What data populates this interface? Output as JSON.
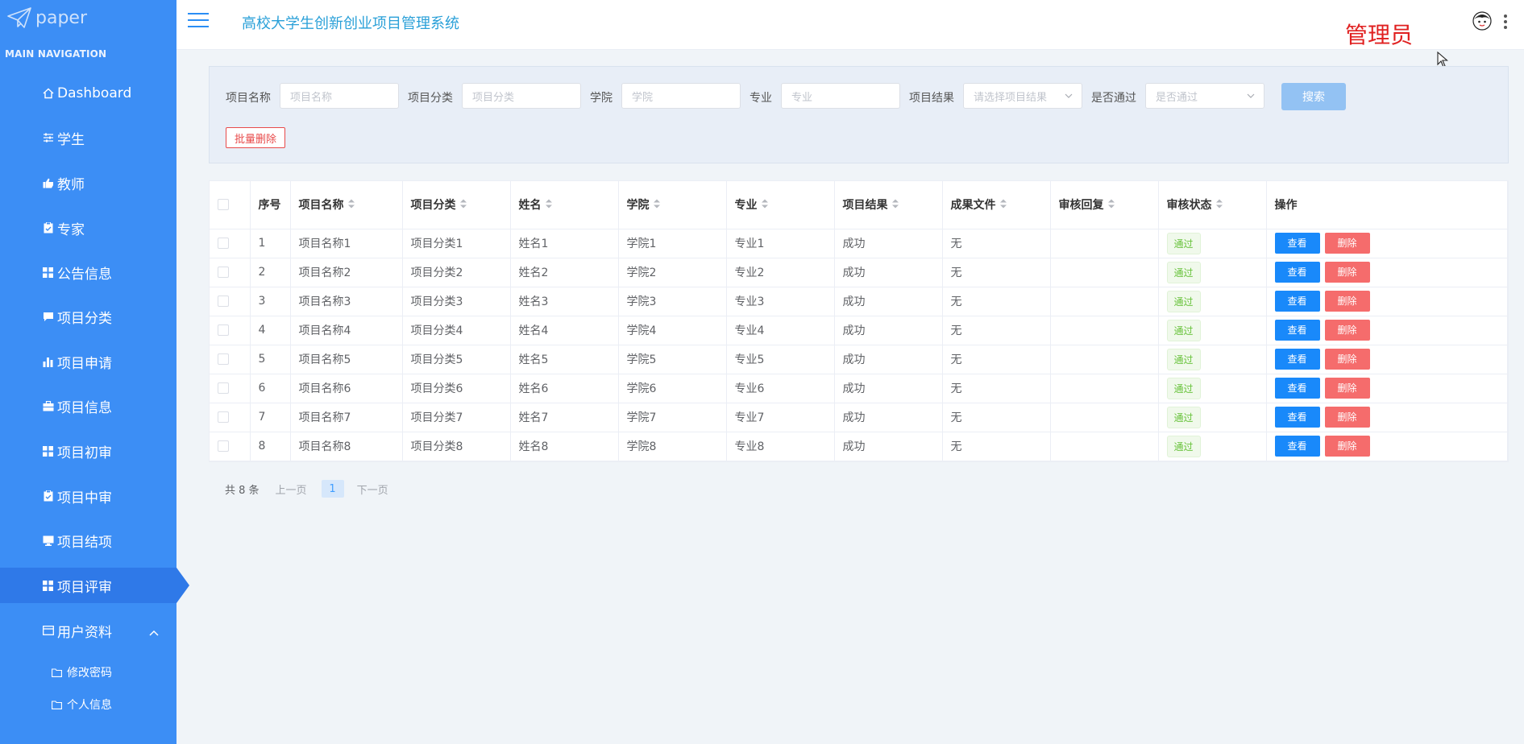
{
  "sidebar": {
    "logo_text": "paper",
    "nav_title": "MAIN NAVIGATION",
    "items": [
      {
        "label": "Dashboard",
        "icon": "home-icon"
      },
      {
        "label": "学生",
        "icon": "sliders-icon"
      },
      {
        "label": "教师",
        "icon": "thumbs-up-icon"
      },
      {
        "label": "专家",
        "icon": "clipboard-icon"
      },
      {
        "label": "公告信息",
        "icon": "grid-icon"
      },
      {
        "label": "项目分类",
        "icon": "comment-icon"
      },
      {
        "label": "项目申请",
        "icon": "bar-chart-icon"
      },
      {
        "label": "项目信息",
        "icon": "briefcase-icon"
      },
      {
        "label": "项目初审",
        "icon": "grid-icon"
      },
      {
        "label": "项目中审",
        "icon": "clipboard-icon"
      },
      {
        "label": "项目结项",
        "icon": "monitor-icon"
      },
      {
        "label": "项目评审",
        "icon": "grid-icon"
      },
      {
        "label": "用户资料",
        "icon": "id-card-icon"
      }
    ],
    "sub_items": [
      {
        "label": "修改密码",
        "icon": "folder-icon"
      },
      {
        "label": "个人信息",
        "icon": "folder-icon"
      }
    ]
  },
  "header": {
    "title": "高校大学生创新创业项目管理系统",
    "role": "管理员"
  },
  "search": {
    "fields": [
      {
        "label": "项目名称",
        "placeholder": "项目名称"
      },
      {
        "label": "项目分类",
        "placeholder": "项目分类"
      },
      {
        "label": "学院",
        "placeholder": "学院"
      },
      {
        "label": "专业",
        "placeholder": "专业"
      },
      {
        "label": "项目结果",
        "placeholder": "请选择项目结果"
      },
      {
        "label": "是否通过",
        "placeholder": "是否通过"
      }
    ],
    "search_button": "搜索",
    "batch_delete": "批量删除"
  },
  "table": {
    "headers": [
      "序号",
      "项目名称",
      "项目分类",
      "姓名",
      "学院",
      "专业",
      "项目结果",
      "成果文件",
      "审核回复",
      "审核状态",
      "操作"
    ],
    "rows": [
      {
        "no": "1",
        "name": "项目名称1",
        "category": "项目分类1",
        "person": "姓名1",
        "college": "学院1",
        "major": "专业1",
        "result": "成功",
        "file": "无",
        "reply": "",
        "status": "通过"
      },
      {
        "no": "2",
        "name": "项目名称2",
        "category": "项目分类2",
        "person": "姓名2",
        "college": "学院2",
        "major": "专业2",
        "result": "成功",
        "file": "无",
        "reply": "",
        "status": "通过"
      },
      {
        "no": "3",
        "name": "项目名称3",
        "category": "项目分类3",
        "person": "姓名3",
        "college": "学院3",
        "major": "专业3",
        "result": "成功",
        "file": "无",
        "reply": "",
        "status": "通过"
      },
      {
        "no": "4",
        "name": "项目名称4",
        "category": "项目分类4",
        "person": "姓名4",
        "college": "学院4",
        "major": "专业4",
        "result": "成功",
        "file": "无",
        "reply": "",
        "status": "通过"
      },
      {
        "no": "5",
        "name": "项目名称5",
        "category": "项目分类5",
        "person": "姓名5",
        "college": "学院5",
        "major": "专业5",
        "result": "成功",
        "file": "无",
        "reply": "",
        "status": "通过"
      },
      {
        "no": "6",
        "name": "项目名称6",
        "category": "项目分类6",
        "person": "姓名6",
        "college": "学院6",
        "major": "专业6",
        "result": "成功",
        "file": "无",
        "reply": "",
        "status": "通过"
      },
      {
        "no": "7",
        "name": "项目名称7",
        "category": "项目分类7",
        "person": "姓名7",
        "college": "学院7",
        "major": "专业7",
        "result": "成功",
        "file": "无",
        "reply": "",
        "status": "通过"
      },
      {
        "no": "8",
        "name": "项目名称8",
        "category": "项目分类8",
        "person": "姓名8",
        "college": "学院8",
        "major": "专业8",
        "result": "成功",
        "file": "无",
        "reply": "",
        "status": "通过"
      }
    ],
    "view_label": "查看",
    "delete_label": "删除"
  },
  "pagination": {
    "total": "共 8 条",
    "prev": "上一页",
    "current": "1",
    "next": "下一页"
  },
  "colors": {
    "sidebar": "#3c8ef5",
    "sidebar_active": "#2f79e8",
    "primary": "#1989fa",
    "danger": "#f56c6c",
    "success": "#67c23a",
    "title": "#2aa0d8",
    "role": "#e02020"
  }
}
